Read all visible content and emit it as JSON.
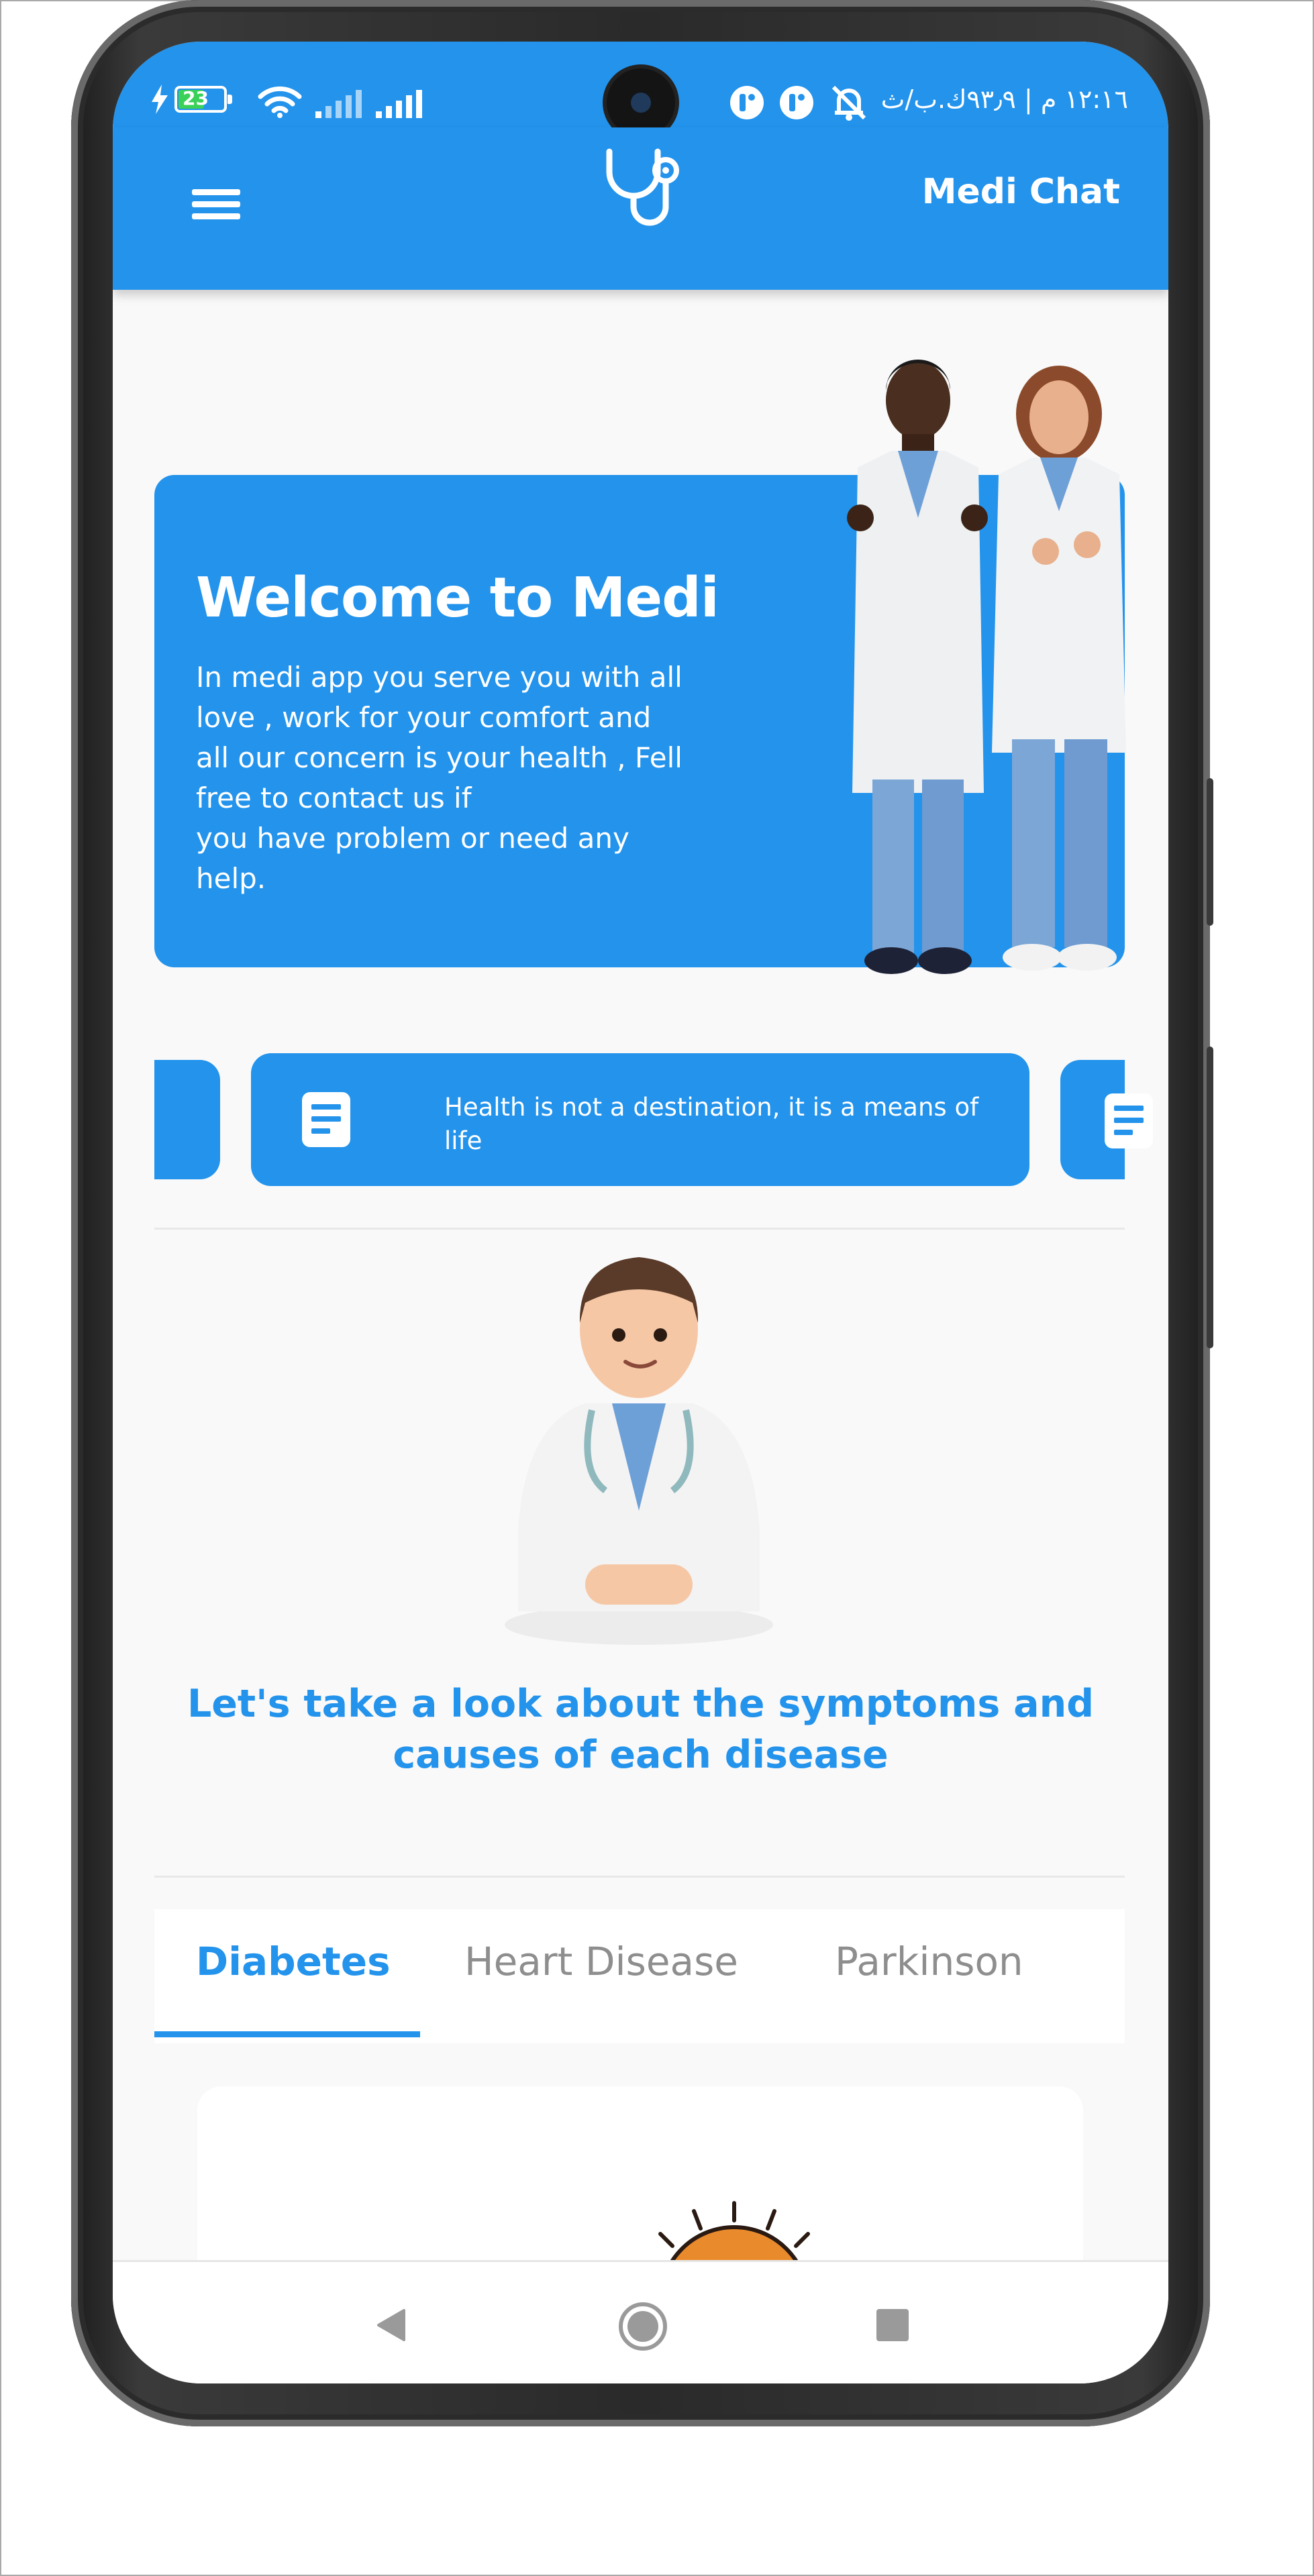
{
  "status_bar": {
    "time_text": "١٢:١٦ م | ٩٣٫٩ك.ب/ث",
    "battery_level": "23"
  },
  "app_bar": {
    "title": "Medi Chat"
  },
  "welcome_card": {
    "title": "Welcome to Medi",
    "description_lines": [
      "In medi app you serve you with all",
      "love , work for your comfort and",
      "all our concern is your health , Fell",
      "free to contact us if",
      "you have problem or need any",
      "help."
    ]
  },
  "quotes": {
    "current_text": "Health is not a destination, it is a means of life"
  },
  "section": {
    "heading": "Let's take a look about the symptoms and causes of each disease"
  },
  "tabs": [
    {
      "label": "Diabetes",
      "active": true
    },
    {
      "label": "Heart Disease",
      "active": false
    },
    {
      "label": "Parkinson",
      "active": false
    }
  ],
  "colors": {
    "primary": "#2393ec",
    "background": "#f9f9f9",
    "tab_inactive": "#8e8e8e"
  }
}
